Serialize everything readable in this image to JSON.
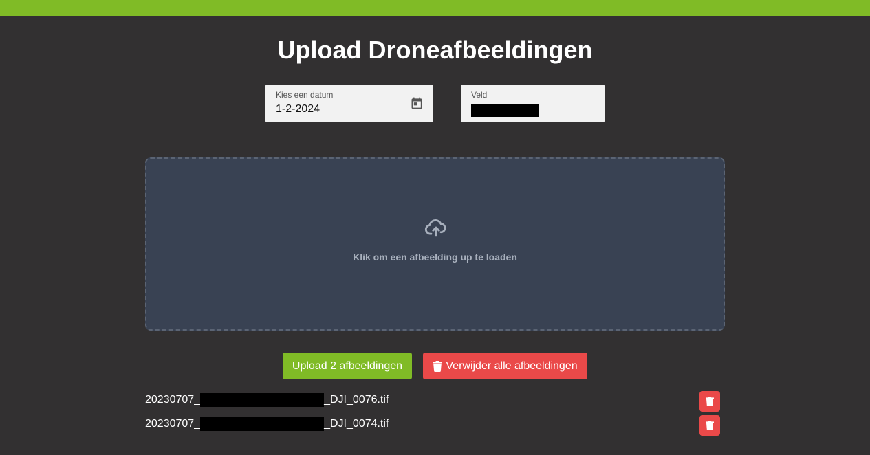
{
  "header": {
    "title": "Upload Droneafbeeldingen"
  },
  "form": {
    "date_label": "Kies een datum",
    "date_value": "1-2-2024",
    "field_label": "Veld"
  },
  "dropzone": {
    "text": "Klik om een afbeelding up te loaden"
  },
  "actions": {
    "upload_label": "Upload 2 afbeeldingen",
    "delete_all_label": "Verwijder alle afbeeldingen"
  },
  "files": [
    {
      "prefix": "20230707_",
      "suffix": "_DJI_0076.tif"
    },
    {
      "prefix": "20230707_",
      "suffix": "_DJI_0074.tif"
    }
  ],
  "colors": {
    "topbar": "#80bb26",
    "background": "#323031",
    "dropzone": "#394253",
    "danger": "#ea4949",
    "primary": "#80bb26"
  },
  "icons": {
    "date": "calendar-icon",
    "upload": "cloud-upload-icon",
    "delete": "trash-icon"
  }
}
